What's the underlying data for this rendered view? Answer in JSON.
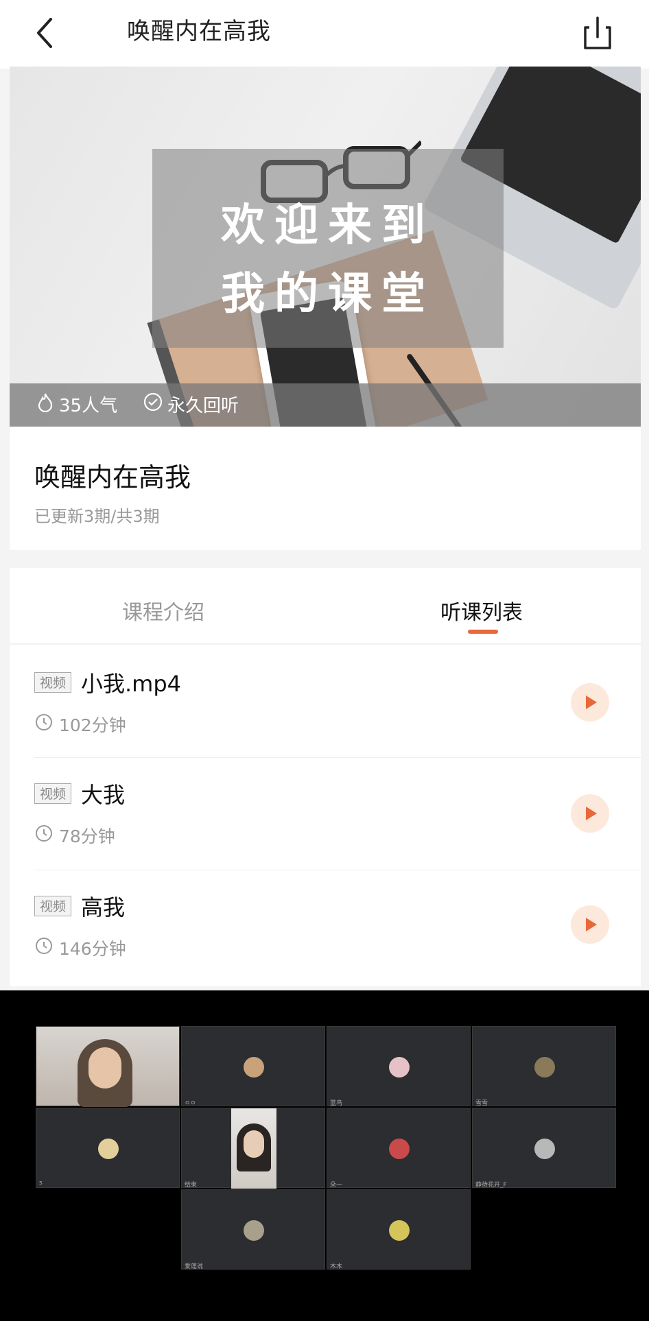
{
  "header": {
    "title": "唤醒内在高我",
    "back_icon": "chevron-left-icon",
    "share_icon": "share-icon"
  },
  "banner": {
    "line1": "欢迎来到",
    "line2": "我的课堂",
    "popularity": "35人气",
    "replay": "永久回听"
  },
  "course": {
    "title": "唤醒内在高我",
    "meta": "已更新3期/共3期"
  },
  "tabs": [
    {
      "label": "课程介绍",
      "active": false
    },
    {
      "label": "听课列表",
      "active": true
    }
  ],
  "lessons": [
    {
      "badge": "视频",
      "title": "小我.mp4",
      "duration": "102分钟"
    },
    {
      "badge": "视频",
      "title": "大我",
      "duration": "78分钟"
    },
    {
      "badge": "视频",
      "title": "高我",
      "duration": "146分钟"
    }
  ],
  "video_grid": {
    "tiles": [
      {
        "name": "",
        "type": "video"
      },
      {
        "name": "ㅇㅇ",
        "type": "avatar",
        "color": "#c9a27a"
      },
      {
        "name": "蓝鸟",
        "type": "avatar",
        "color": "#e6c2c8"
      },
      {
        "name": "雪雪",
        "type": "avatar",
        "color": "#8a7a5a"
      },
      {
        "name": "s",
        "type": "avatar",
        "color": "#e2cf9a"
      },
      {
        "name": "结束",
        "type": "video"
      },
      {
        "name": "朵一",
        "type": "avatar",
        "color": "#c94a4a"
      },
      {
        "name": "静待花开_F",
        "type": "avatar",
        "color": "#b8b8b8"
      },
      {
        "name": "爱莲说",
        "type": "avatar",
        "color": "#a8a08a"
      },
      {
        "name": "木木",
        "type": "avatar",
        "color": "#d4c45a"
      }
    ]
  },
  "colors": {
    "accent": "#e8683a",
    "play_bg": "#fde8dc"
  }
}
